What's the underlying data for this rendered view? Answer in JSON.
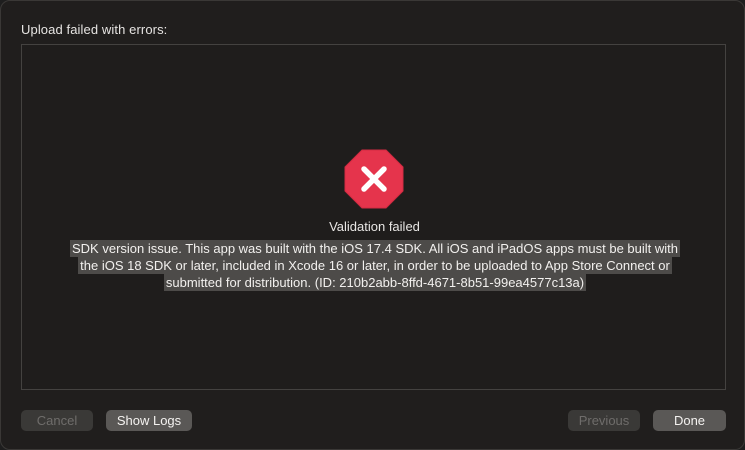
{
  "dialog": {
    "heading": "Upload failed with errors:"
  },
  "error": {
    "icon": "error-octagon-x-icon",
    "icon_color": "#e5344c",
    "title": "Validation failed",
    "message": "SDK version issue. This app was built with the iOS 17.4 SDK. All iOS and iPadOS apps must be built with the iOS 18 SDK or later, included in Xcode 16 or later, in order to be uploaded to App Store Connect or submitted for distribution. (ID: 210b2abb-8ffd-4671-8b51-99ea4577c13a)"
  },
  "buttons": {
    "cancel": "Cancel",
    "show_logs": "Show Logs",
    "previous": "Previous",
    "done": "Done"
  }
}
